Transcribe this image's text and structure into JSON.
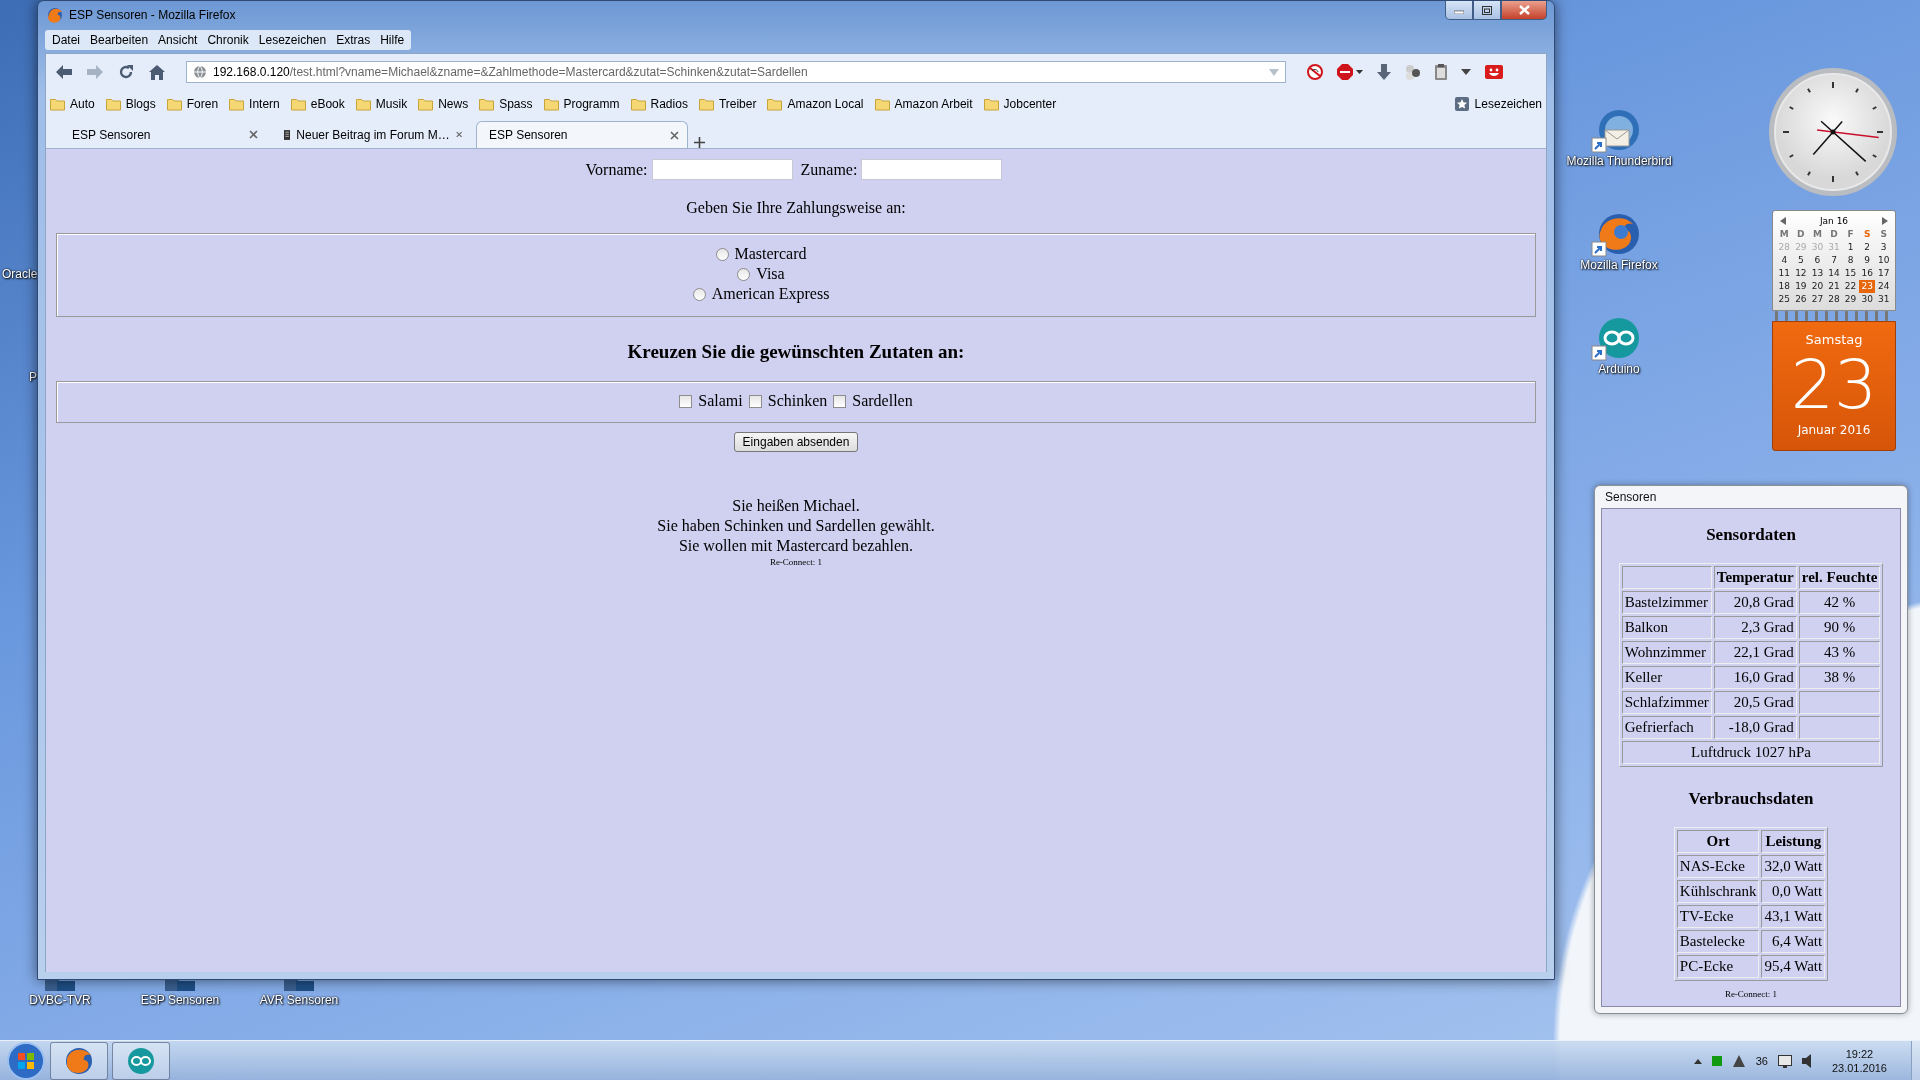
{
  "desktop": {
    "edge_labels": [
      "Oracle",
      "P"
    ],
    "icons": [
      {
        "kind": "app",
        "label": "DVBC-TVR"
      },
      {
        "kind": "app",
        "label": "ESP Sensoren"
      },
      {
        "kind": "app",
        "label": "AVR Sensoren"
      },
      {
        "kind": "mail",
        "label": "Mozilla Thunderbird"
      },
      {
        "kind": "browser",
        "label": "Mozilla Firefox"
      },
      {
        "kind": "arduino",
        "label": "Arduino"
      }
    ]
  },
  "browser": {
    "title": "ESP Sensoren - Mozilla Firefox",
    "menu": [
      "Datei",
      "Bearbeiten",
      "Ansicht",
      "Chronik",
      "Lesezeichen",
      "Extras",
      "Hilfe"
    ],
    "url": {
      "host": "192.168.0.120",
      "path": "/test.html?vname=Michael&zname=&Zahlmethode=Mastercard&zutat=Schinken&zutat=Sardellen"
    },
    "bookmarks": [
      "Auto",
      "Blogs",
      "Foren",
      "Intern",
      "eBook",
      "Musik",
      "News",
      "Spass",
      "Programm",
      "Radios",
      "Treiber",
      "Amazon Local",
      "Amazon Arbeit",
      "Jobcenter"
    ],
    "bookmarks_menu": "Lesezeichen",
    "tabs": [
      {
        "label": "ESP Sensoren",
        "favicon": false,
        "selected": false
      },
      {
        "label": "Neuer Beitrag im Forum M…",
        "favicon": true,
        "selected": false
      },
      {
        "label": "ESP Sensoren",
        "favicon": false,
        "selected": true
      }
    ]
  },
  "page": {
    "name_fields": [
      {
        "label": "Vorname:"
      },
      {
        "label": "Zuname:"
      }
    ],
    "payment_prompt": "Geben Sie Ihre Zahlungsweise an:",
    "payment_options": [
      {
        "label": "Mastercard",
        "selected": false
      },
      {
        "label": "Visa",
        "selected": false
      },
      {
        "label": "American Express",
        "selected": false
      }
    ],
    "ingredients_heading": "Kreuzen Sie die gewünschten Zutaten an:",
    "ingredients": [
      {
        "label": "Salami",
        "checked": false
      },
      {
        "label": "Schinken",
        "checked": false
      },
      {
        "label": "Sardellen",
        "checked": false
      }
    ],
    "submit": "Eingaben absenden",
    "result_lines": [
      "Sie heißen Michael.",
      "Sie haben Schinken und Sardellen gewählt.",
      "Sie wollen mit Mastercard bezahlen."
    ],
    "reconnect": "Re-Connect: 1"
  },
  "calendar": {
    "month": "Jan 16",
    "weekdays": [
      {
        "label": "M",
        "selected": false
      },
      {
        "label": "D",
        "selected": false
      },
      {
        "label": "M",
        "selected": false
      },
      {
        "label": "D",
        "selected": false
      },
      {
        "label": "F",
        "selected": false
      },
      {
        "label": "S",
        "selected": true
      },
      {
        "label": "S",
        "selected": false
      }
    ],
    "days": [
      {
        "label": "28",
        "muted": true,
        "selected": false
      },
      {
        "label": "29",
        "muted": true,
        "selected": false
      },
      {
        "label": "30",
        "muted": true,
        "selected": false
      },
      {
        "label": "31",
        "muted": true,
        "selected": false
      },
      {
        "label": "1",
        "muted": false,
        "selected": false
      },
      {
        "label": "2",
        "muted": false,
        "selected": false
      },
      {
        "label": "3",
        "muted": false,
        "selected": false
      },
      {
        "label": "4",
        "muted": false,
        "selected": false
      },
      {
        "label": "5",
        "muted": false,
        "selected": false
      },
      {
        "label": "6",
        "muted": false,
        "selected": false
      },
      {
        "label": "7",
        "muted": false,
        "selected": false
      },
      {
        "label": "8",
        "muted": false,
        "selected": false
      },
      {
        "label": "9",
        "muted": false,
        "selected": false
      },
      {
        "label": "10",
        "muted": false,
        "selected": false
      },
      {
        "label": "11",
        "muted": false,
        "selected": false
      },
      {
        "label": "12",
        "muted": false,
        "selected": false
      },
      {
        "label": "13",
        "muted": false,
        "selected": false
      },
      {
        "label": "14",
        "muted": false,
        "selected": false
      },
      {
        "label": "15",
        "muted": false,
        "selected": false
      },
      {
        "label": "16",
        "muted": false,
        "selected": false
      },
      {
        "label": "17",
        "muted": false,
        "selected": false
      },
      {
        "label": "18",
        "muted": false,
        "selected": false
      },
      {
        "label": "19",
        "muted": false,
        "selected": false
      },
      {
        "label": "20",
        "muted": false,
        "selected": false
      },
      {
        "label": "21",
        "muted": false,
        "selected": false
      },
      {
        "label": "22",
        "muted": false,
        "selected": false
      },
      {
        "label": "23",
        "muted": false,
        "selected": true
      },
      {
        "label": "24",
        "muted": false,
        "selected": false
      },
      {
        "label": "25",
        "muted": false,
        "selected": false
      },
      {
        "label": "26",
        "muted": false,
        "selected": false
      },
      {
        "label": "27",
        "muted": false,
        "selected": false
      },
      {
        "label": "28",
        "muted": false,
        "selected": false
      },
      {
        "label": "29",
        "muted": false,
        "selected": false
      },
      {
        "label": "30",
        "muted": false,
        "selected": false
      },
      {
        "label": "31",
        "muted": false,
        "selected": false
      }
    ],
    "weekday": "Samstag",
    "day": "23",
    "month_year": "Januar 2016"
  },
  "sensor_window": {
    "title": "Sensoren",
    "sensor_heading": "Sensordaten",
    "sensor_columns": [
      "Temperatur",
      "rel. Feuchte"
    ],
    "sensor_rows": [
      {
        "room": "Bastelzimmer",
        "temperature": "20,8 Grad",
        "humidity": "42 %"
      },
      {
        "room": "Balkon",
        "temperature": "2,3 Grad",
        "humidity": "90 %"
      },
      {
        "room": "Wohnzimmer",
        "temperature": "22,1 Grad",
        "humidity": "43 %"
      },
      {
        "room": "Keller",
        "temperature": "16,0 Grad",
        "humidity": "38 %"
      },
      {
        "room": "Schlafzimmer",
        "temperature": "20,5 Grad"
      },
      {
        "room": "Gefrierfach",
        "temperature": "-18,0 Grad"
      }
    ],
    "pressure": "Luftdruck 1027 hPa",
    "consumption_heading": "Verbrauchsdaten",
    "consumption_columns": [
      "Ort",
      "Leistung"
    ],
    "consumption_rows": [
      {
        "place": "NAS-Ecke",
        "power": "32,0 Watt"
      },
      {
        "place": "Kühlschrank",
        "power": "0,0 Watt"
      },
      {
        "place": "TV-Ecke",
        "power": "43,1 Watt"
      },
      {
        "place": "Bastelecke",
        "power": "6,4 Watt"
      },
      {
        "place": "PC-Ecke",
        "power": "95,4 Watt"
      }
    ],
    "reconnect": "Re-Connect: 1"
  },
  "taskbar": {
    "tray_number": "36",
    "time": "19:22",
    "date": "23.01.2016"
  }
}
